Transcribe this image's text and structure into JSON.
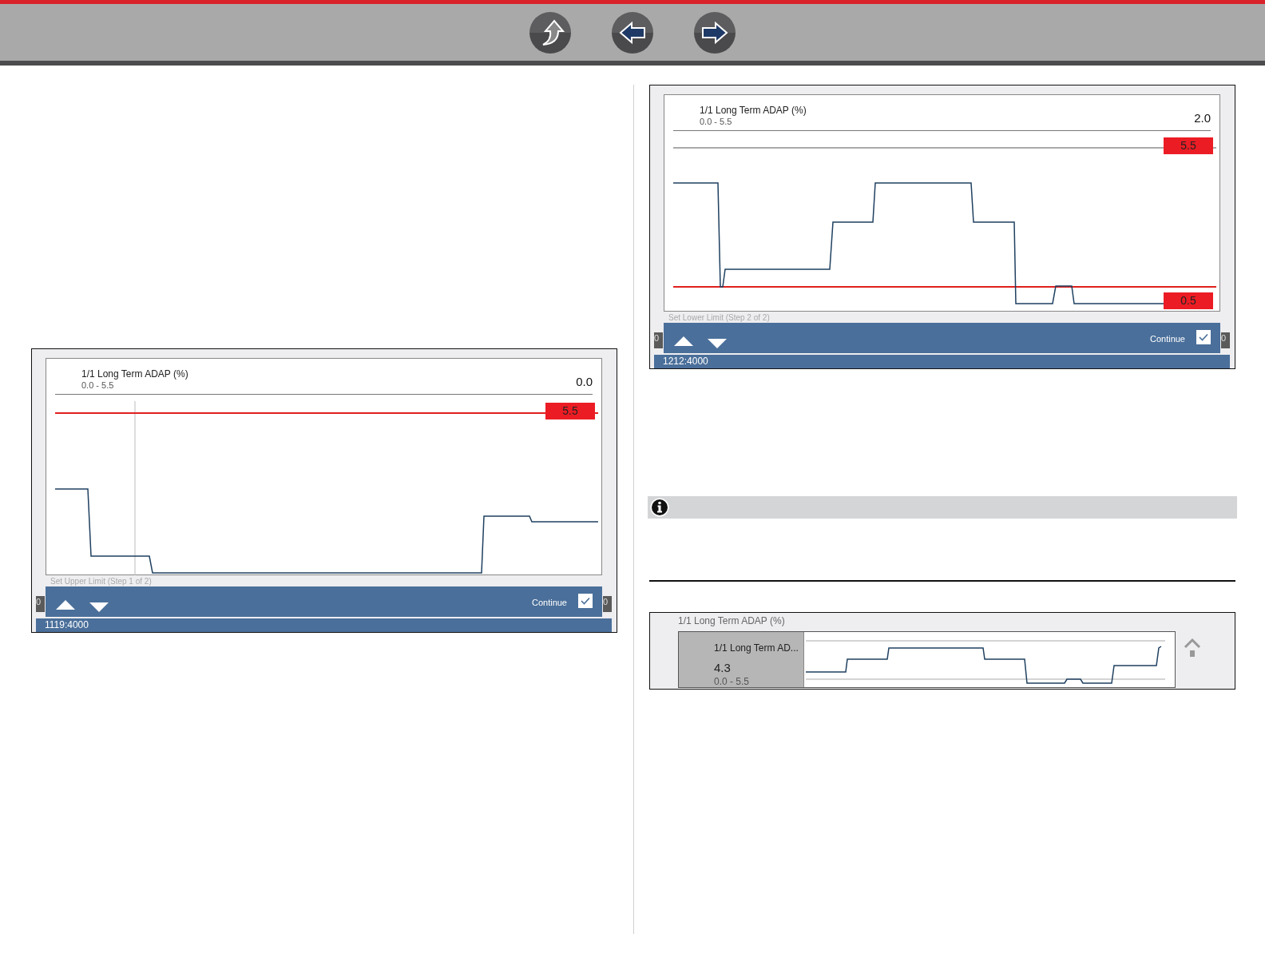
{
  "toolbar": {
    "buttons": [
      {
        "kind": "up"
      },
      {
        "kind": "back"
      },
      {
        "kind": "forward"
      }
    ]
  },
  "screens": [
    {
      "title": "1/1 Long Term ADAP (%)",
      "range": "0.0 - 5.5",
      "value": "0.0",
      "limits": [
        {
          "kind": "upper",
          "label": "5.5",
          "active": true
        }
      ],
      "step": "Set Upper Limit (Step 1 of 2)",
      "continue": "Continue",
      "continue_checked": true,
      "edge_labels": [
        "0",
        "0"
      ],
      "status": "1119:4000"
    },
    {
      "title": "1/1 Long Term ADAP (%)",
      "range": "0.0 - 5.5",
      "value": "2.0",
      "limits": [
        {
          "kind": "upper",
          "label": "5.5",
          "active": false
        },
        {
          "kind": "lower",
          "label": "0.5",
          "active": true
        }
      ],
      "step": "Set Lower Limit (Step 2 of 2)",
      "continue": "Continue",
      "continue_checked": true,
      "edge_labels": [
        "0",
        "0"
      ],
      "status": "1212:4000"
    }
  ],
  "graph_widget": {
    "label": "1/1 Long Term ADAP (%)",
    "name": "1/1 Long Term AD...",
    "value": "4.3",
    "range": "0.0 - 5.5"
  }
}
